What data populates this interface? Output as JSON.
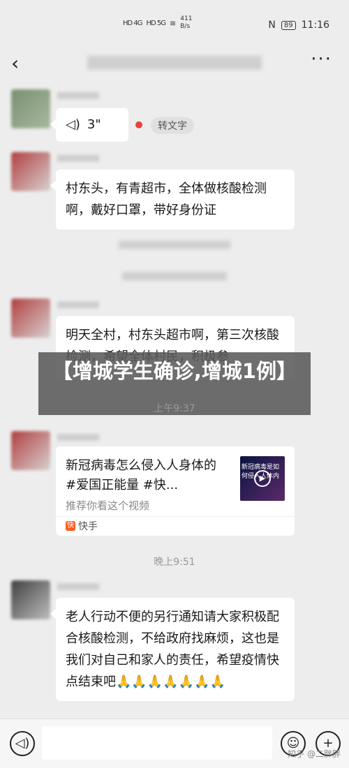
{
  "status_bar": {
    "network_left": "HD 4G",
    "network_right": "HD 5G",
    "speed_value": "411",
    "speed_unit": "B/s",
    "battery": "89",
    "time": "11:16"
  },
  "nav": {
    "back_icon": "back-chevron-icon",
    "more_icon": "more-dots-icon"
  },
  "messages": {
    "voice_duration": "3\"",
    "to_text_label": "转文字",
    "msg1": "村东头，有青超市，全体做核酸检测啊，戴好口罩，带好身份证",
    "msg2": "明天全村，村东头超市啊，第三次核酸检测，希望全体村民，积极参",
    "msg4": "老人行动不便的另行通知请大家积极配合核酸检测，不给政府找麻烦，这也是我们对自己和家人的责任，希望疫情快点结束吧🙏🙏🙏🙏🙏🙏🙏"
  },
  "banner": {
    "text": "【增城学生确诊,增城1例】"
  },
  "times": {
    "t1": "上午9:37",
    "t2": "晚上9:51"
  },
  "card": {
    "title": "新冠病毒怎么侵入人身体的 #爱国正能量 #快...",
    "subtitle": "推荐你看这个视频",
    "source": "快手",
    "thumb_text": "新冠病毒是如何侵入人体内"
  },
  "input_bar": {
    "voice_icon": "voice-input-icon",
    "emoji_icon": "emoji-icon",
    "plus_icon": "plus-icon"
  },
  "watermark": "知乎 @二胖胖"
}
